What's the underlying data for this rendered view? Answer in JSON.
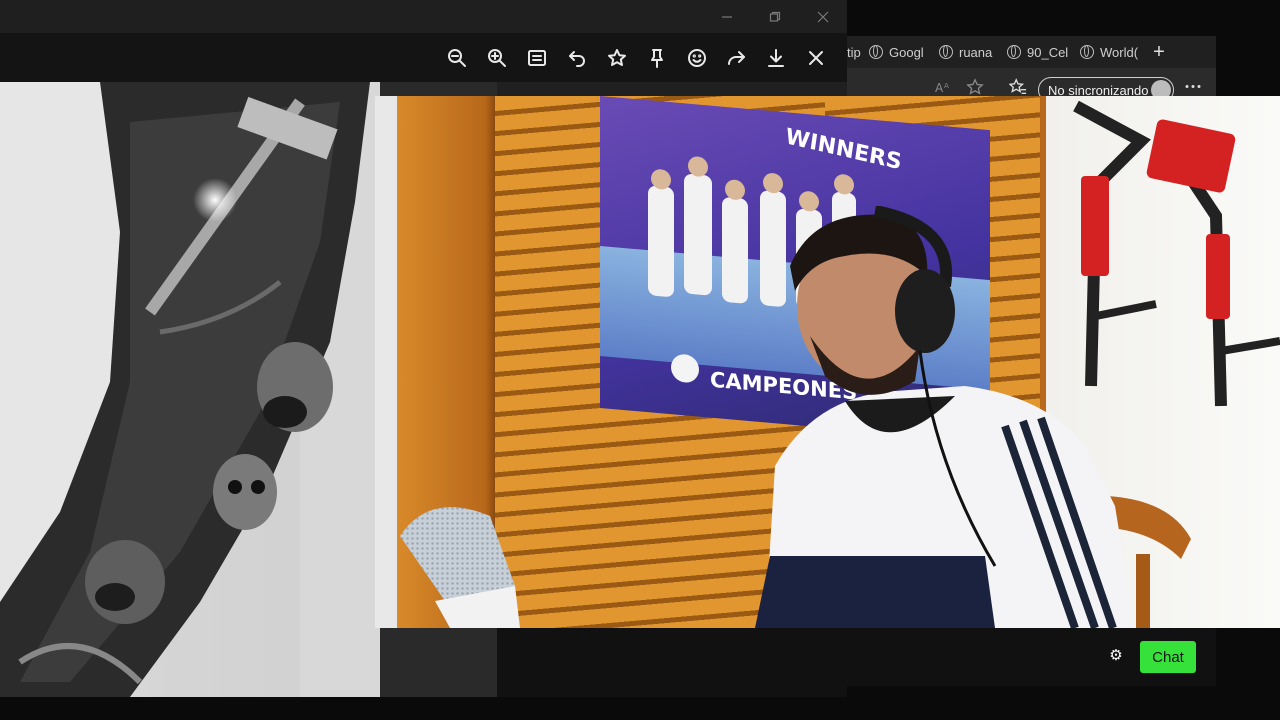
{
  "viewer": {
    "window_controls": [
      "minimize",
      "restore",
      "close"
    ],
    "toolbar_icons": [
      "zoom-out-icon",
      "zoom-in-icon",
      "slideshow-icon",
      "rotate-icon",
      "favorite-icon",
      "pin-icon",
      "emoji-icon",
      "share-icon",
      "download-icon",
      "close-icon"
    ]
  },
  "browser": {
    "tabs": [
      {
        "label": "tip"
      },
      {
        "label": "Googl"
      },
      {
        "label": "ruana"
      },
      {
        "label": "90_Cel"
      },
      {
        "label": "World("
      }
    ],
    "new_tab_label": "+",
    "sync_label": "No sincronizando",
    "chat_label": "Chat"
  },
  "webcam": {
    "poster_top_text": "WINNERS",
    "poster_bottom_text": "CAMPEONES"
  },
  "colors": {
    "chat_button": "#36e23a",
    "viewer_toolbar": "#141414",
    "shutter": "#e2962f"
  }
}
